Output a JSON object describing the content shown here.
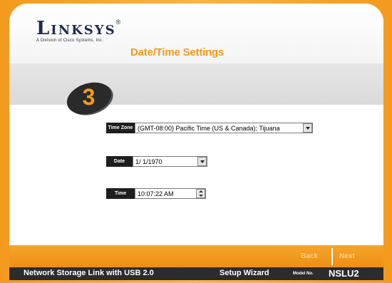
{
  "brand": {
    "logo_text": "Linksys",
    "registered_mark": "®",
    "tagline": "A Division of Cisco Systems, Inc."
  },
  "page": {
    "title": "Date/Time Settings",
    "step_number": "3"
  },
  "form": {
    "time_zone": {
      "label": "Time Zone",
      "value": "(GMT-08:00) Pacific Time (US & Canada); Tijuana"
    },
    "date": {
      "label": "Date",
      "value": "1/ 1/1970"
    },
    "time": {
      "label": "Time",
      "value": "10:07:22 AM"
    }
  },
  "nav": {
    "back_label": "Back",
    "next_label": "Next"
  },
  "footer": {
    "product": "Network Storage Link with USB 2.0",
    "wizard": "Setup Wizard",
    "model_label": "Model No.",
    "model": "NSLU2"
  },
  "colors": {
    "accent": "#f39a1d",
    "dark": "#2c2c2c",
    "logo": "#1e2b52"
  }
}
